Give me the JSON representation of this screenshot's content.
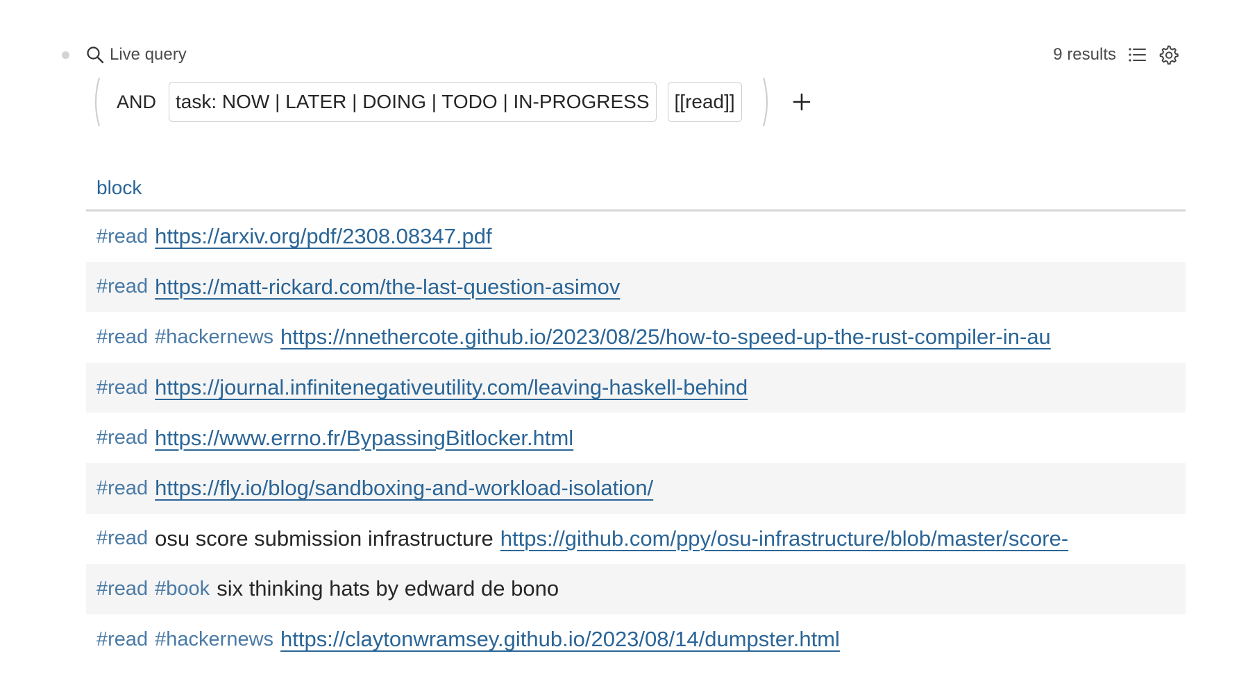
{
  "query": {
    "title": "Live query",
    "results_count": "9 results",
    "icons": {
      "search": "search-icon",
      "list": "list-icon",
      "settings": "gear-icon",
      "add": "plus-icon"
    },
    "builder": {
      "operator": "AND",
      "clauses": [
        "task: NOW | LATER | DOING | TODO | IN-PROGRESS",
        "[[read]]"
      ]
    }
  },
  "table": {
    "column": "block",
    "rows": [
      {
        "tags": [
          "#read"
        ],
        "text": "",
        "link": "https://arxiv.org/pdf/2308.08347.pdf"
      },
      {
        "tags": [
          "#read"
        ],
        "text": "",
        "link": "https://matt-rickard.com/the-last-question-asimov"
      },
      {
        "tags": [
          "#read",
          "#hackernews"
        ],
        "text": "",
        "link": "https://nnethercote.github.io/2023/08/25/how-to-speed-up-the-rust-compiler-in-au"
      },
      {
        "tags": [
          "#read"
        ],
        "text": "",
        "link": "https://journal.infinitenegativeutility.com/leaving-haskell-behind"
      },
      {
        "tags": [
          "#read"
        ],
        "text": "",
        "link": "https://www.errno.fr/BypassingBitlocker.html"
      },
      {
        "tags": [
          "#read"
        ],
        "text": "",
        "link": "https://fly.io/blog/sandboxing-and-workload-isolation/"
      },
      {
        "tags": [
          "#read"
        ],
        "text": "osu score submission infrastructure",
        "link": "https://github.com/ppy/osu-infrastructure/blob/master/score-"
      },
      {
        "tags": [
          "#read",
          "#book"
        ],
        "text": "six thinking hats by edward de bono",
        "link": ""
      },
      {
        "tags": [
          "#read",
          "#hackernews"
        ],
        "text": "",
        "link": "https://claytonwramsey.github.io/2023/08/14/dumpster.html"
      }
    ]
  },
  "colors": {
    "link": "#2a6597",
    "tag": "#4a7aa6",
    "row_alt_bg": "#f5f5f5",
    "divider": "#d6d6d6"
  }
}
